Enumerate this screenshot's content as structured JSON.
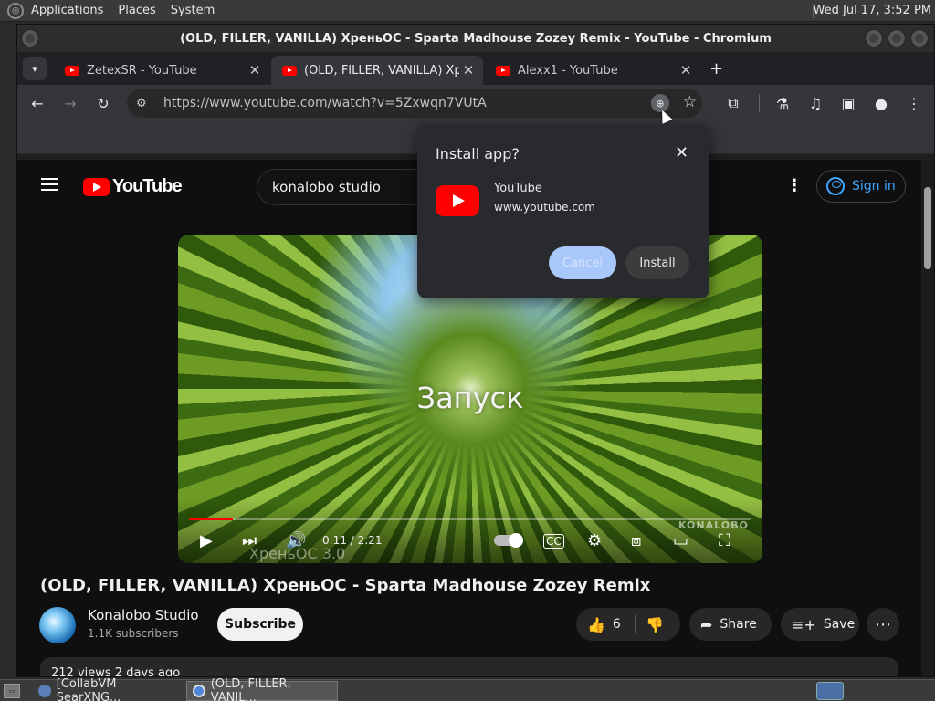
{
  "panel": {
    "menus": [
      "Applications",
      "Places",
      "System"
    ],
    "clock": "Wed Jul 17,  3:52 PM"
  },
  "window": {
    "title": "(OLD, FILLER, VANILLA) ХреньОС - Sparta Madhouse Zozey Remix - YouTube - Chromium"
  },
  "tabs": [
    {
      "label": "ZetexSR - YouTube",
      "active": false
    },
    {
      "label": "(OLD, FILLER, VANILLA) Хрень",
      "active": true
    },
    {
      "label": "Alexx1 - YouTube",
      "active": false
    }
  ],
  "omnibox": {
    "url": "https://www.youtube.com/watch?v=5Zxwqn7VUtA"
  },
  "youtube": {
    "logo_text": "YouTube",
    "search_value": "konalobo studio",
    "sign_in": "Sign in",
    "player": {
      "overlay_text": "Запуск",
      "time": "0:11 / 2:21",
      "progress_fraction": 0.078,
      "watermark": "KONALOBO",
      "watermark2": "ХреньОС 3.0"
    },
    "video_title": "(OLD, FILLER, VANILLA) ХреньОС - Sparta Madhouse Zozey Remix",
    "channel_name": "Konalobo Studio",
    "subscribers": "1.1K subscribers",
    "subscribe": "Subscribe",
    "likes": "6",
    "share": "Share",
    "save": "Save",
    "description": "212 views  2 days ago"
  },
  "dialog": {
    "title": "Install app?",
    "app_name": "YouTube",
    "origin": "www.youtube.com",
    "cancel": "Cancel",
    "install": "Install"
  },
  "taskbar": {
    "tasks": [
      "[CollabVM SearXNG...",
      "(OLD, FILLER, VANIL..."
    ]
  },
  "colors": {
    "youtube_red": "#ff0000",
    "link_blue": "#3ea6ff",
    "cancel_blue": "#a8c7fa"
  }
}
